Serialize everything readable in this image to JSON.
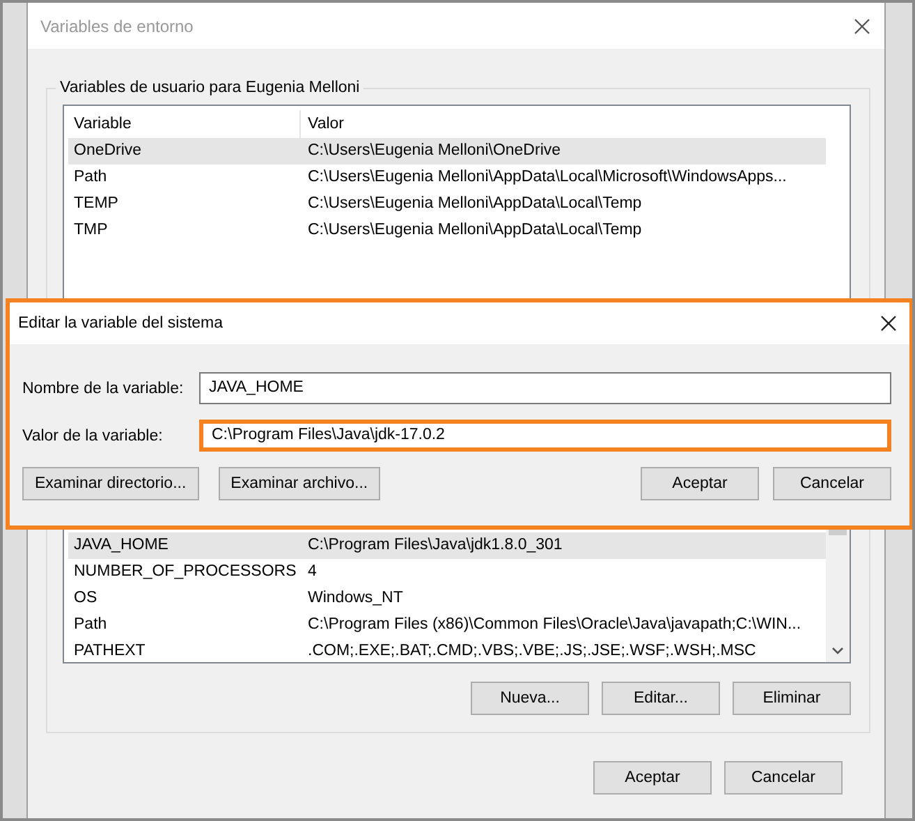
{
  "window": {
    "title": "Variables de entorno"
  },
  "user_variables": {
    "legend": "Variables de usuario para Eugenia Melloni",
    "columns": [
      "Variable",
      "Valor"
    ],
    "rows": [
      {
        "variable": "OneDrive",
        "value": "C:\\Users\\Eugenia Melloni\\OneDrive",
        "selected": true
      },
      {
        "variable": "Path",
        "value": "C:\\Users\\Eugenia Melloni\\AppData\\Local\\Microsoft\\WindowsApps...",
        "selected": false
      },
      {
        "variable": "TEMP",
        "value": "C:\\Users\\Eugenia Melloni\\AppData\\Local\\Temp",
        "selected": false
      },
      {
        "variable": "TMP",
        "value": "C:\\Users\\Eugenia Melloni\\AppData\\Local\\Temp",
        "selected": false
      }
    ]
  },
  "system_variables": {
    "rows": [
      {
        "variable": "JAVA_HOME",
        "value": "C:\\Program Files\\Java\\jdk1.8.0_301",
        "selected": true
      },
      {
        "variable": "NUMBER_OF_PROCESSORS",
        "value": "4",
        "selected": false
      },
      {
        "variable": "OS",
        "value": "Windows_NT",
        "selected": false
      },
      {
        "variable": "Path",
        "value": "C:\\Program Files (x86)\\Common Files\\Oracle\\Java\\javapath;C:\\WIN...",
        "selected": false
      },
      {
        "variable": "PATHEXT",
        "value": ".COM;.EXE;.BAT;.CMD;.VBS;.VBE;.JS;.JSE;.WSF;.WSH;.MSC",
        "selected": false
      }
    ],
    "buttons": [
      "Nueva...",
      "Editar...",
      "Eliminar"
    ]
  },
  "footer_buttons": [
    "Aceptar",
    "Cancelar"
  ],
  "edit_dialog": {
    "title": "Editar la variable del sistema",
    "highlighted": true,
    "fields": [
      {
        "label": "Nombre de la variable:",
        "value": "JAVA_HOME",
        "highlighted": false
      },
      {
        "label": "Valor de la variable:",
        "value": "C:\\Program Files\\Java\\jdk-17.0.2",
        "highlighted": true
      }
    ],
    "left_buttons": [
      "Examinar directorio...",
      "Examinar archivo..."
    ],
    "right_buttons": [
      "Aceptar",
      "Cancelar"
    ]
  }
}
